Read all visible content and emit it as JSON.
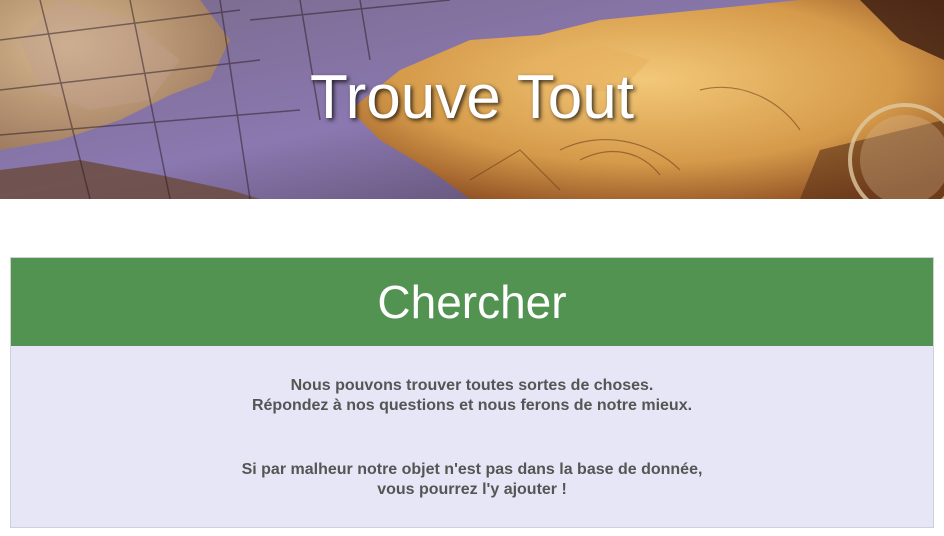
{
  "header": {
    "title": "Trouve Tout"
  },
  "search_panel": {
    "title": "Chercher",
    "intro_line1": "Nous pouvons trouver toutes sortes de choses.",
    "intro_line2": "Répondez à nos questions et nous ferons de notre mieux.",
    "note_line1": "Si par malheur notre objet n'est pas dans la base de donnée,",
    "note_line2": "vous pourrez l'y ajouter !"
  },
  "colors": {
    "panel_header_bg": "#529351",
    "panel_body_bg": "#e6e6f6",
    "body_text": "#555555"
  }
}
